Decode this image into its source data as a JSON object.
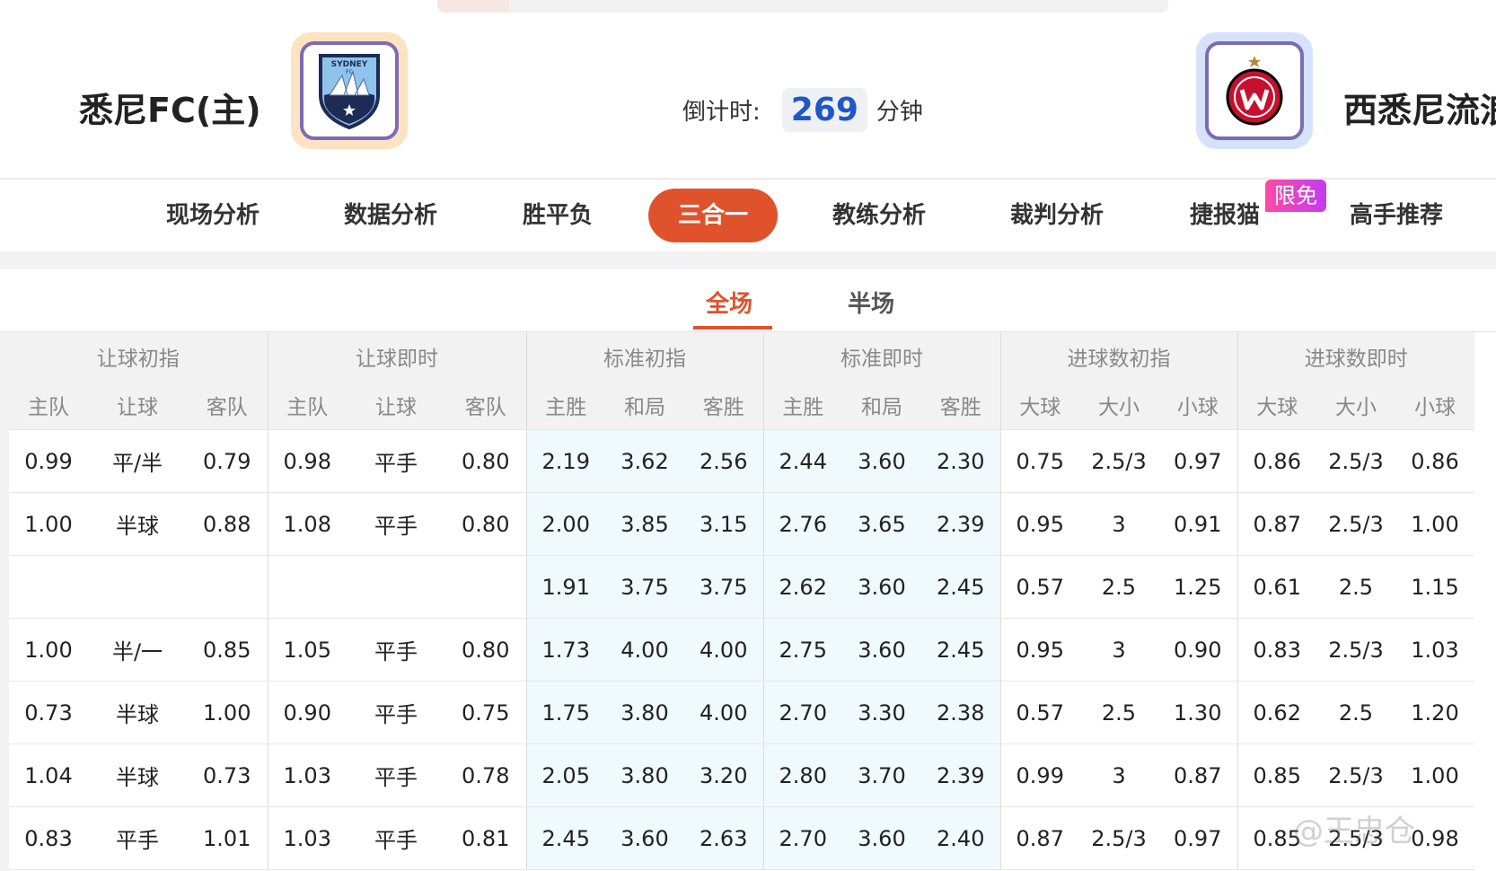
{
  "match": {
    "home_team": "悉尼FC(主)",
    "away_team": "西悉尼流浪者",
    "countdown_label": "倒计时:",
    "countdown_value": "269",
    "countdown_unit": "分钟"
  },
  "home_logo": {
    "text": "SYDNEY",
    "sub": "FC",
    "icon": "sydney-fc-crest-icon"
  },
  "away_logo": {
    "icon": "western-sydney-wanderers-crest-icon"
  },
  "tabs": [
    {
      "label": "现场分析"
    },
    {
      "label": "数据分析"
    },
    {
      "label": "胜平负"
    },
    {
      "label": "三合一",
      "active": true
    },
    {
      "label": "教练分析"
    },
    {
      "label": "裁判分析"
    },
    {
      "label": "捷报猫"
    },
    {
      "label": "高手推荐"
    }
  ],
  "free_badge": "限免",
  "subtabs": [
    {
      "label": "全场",
      "active": true
    },
    {
      "label": "半场"
    }
  ],
  "table": {
    "groups": [
      "让球初指",
      "让球即时",
      "标准初指",
      "标准即时",
      "进球数初指",
      "进球数即时"
    ],
    "columns": [
      "主队",
      "让球",
      "客队",
      "主队",
      "让球",
      "客队",
      "主胜",
      "和局",
      "客胜",
      "主胜",
      "和局",
      "客胜",
      "大球",
      "大小",
      "小球",
      "大球",
      "大小",
      "小球"
    ],
    "rows": [
      [
        "0.99",
        "平/半",
        "0.79",
        "0.98",
        "平手",
        "0.80",
        "2.19",
        "3.62",
        "2.56",
        "2.44",
        "3.60",
        "2.30",
        "0.75",
        "2.5/3",
        "0.97",
        "0.86",
        "2.5/3",
        "0.86"
      ],
      [
        "1.00",
        "半球",
        "0.88",
        "1.08",
        "平手",
        "0.80",
        "2.00",
        "3.85",
        "3.15",
        "2.76",
        "3.65",
        "2.39",
        "0.95",
        "3",
        "0.91",
        "0.87",
        "2.5/3",
        "1.00"
      ],
      [
        "",
        "",
        "",
        "",
        "",
        "",
        "1.91",
        "3.75",
        "3.75",
        "2.62",
        "3.60",
        "2.45",
        "0.57",
        "2.5",
        "1.25",
        "0.61",
        "2.5",
        "1.15"
      ],
      [
        "1.00",
        "半/一",
        "0.85",
        "1.05",
        "平手",
        "0.80",
        "1.73",
        "4.00",
        "4.00",
        "2.75",
        "3.60",
        "2.45",
        "0.95",
        "3",
        "0.90",
        "0.83",
        "2.5/3",
        "1.03"
      ],
      [
        "0.73",
        "半球",
        "1.00",
        "0.90",
        "平手",
        "0.75",
        "1.75",
        "3.80",
        "4.00",
        "2.70",
        "3.30",
        "2.38",
        "0.57",
        "2.5",
        "1.30",
        "0.62",
        "2.5",
        "1.20"
      ],
      [
        "1.04",
        "半球",
        "0.73",
        "1.03",
        "平手",
        "0.78",
        "2.05",
        "3.80",
        "3.20",
        "2.80",
        "3.70",
        "2.39",
        "0.99",
        "3",
        "0.87",
        "0.85",
        "2.5/3",
        "1.00"
      ],
      [
        "0.83",
        "平手",
        "1.01",
        "1.03",
        "平手",
        "0.81",
        "2.45",
        "3.60",
        "2.63",
        "2.70",
        "3.60",
        "2.40",
        "0.87",
        "2.5/3",
        "0.97",
        "0.85",
        "2.5/3",
        "0.98"
      ]
    ]
  },
  "watermark": "@王忠仓",
  "colors": {
    "accent": "#e0522c",
    "live_value": "#1f57c8",
    "badge": "#e83fb8"
  }
}
